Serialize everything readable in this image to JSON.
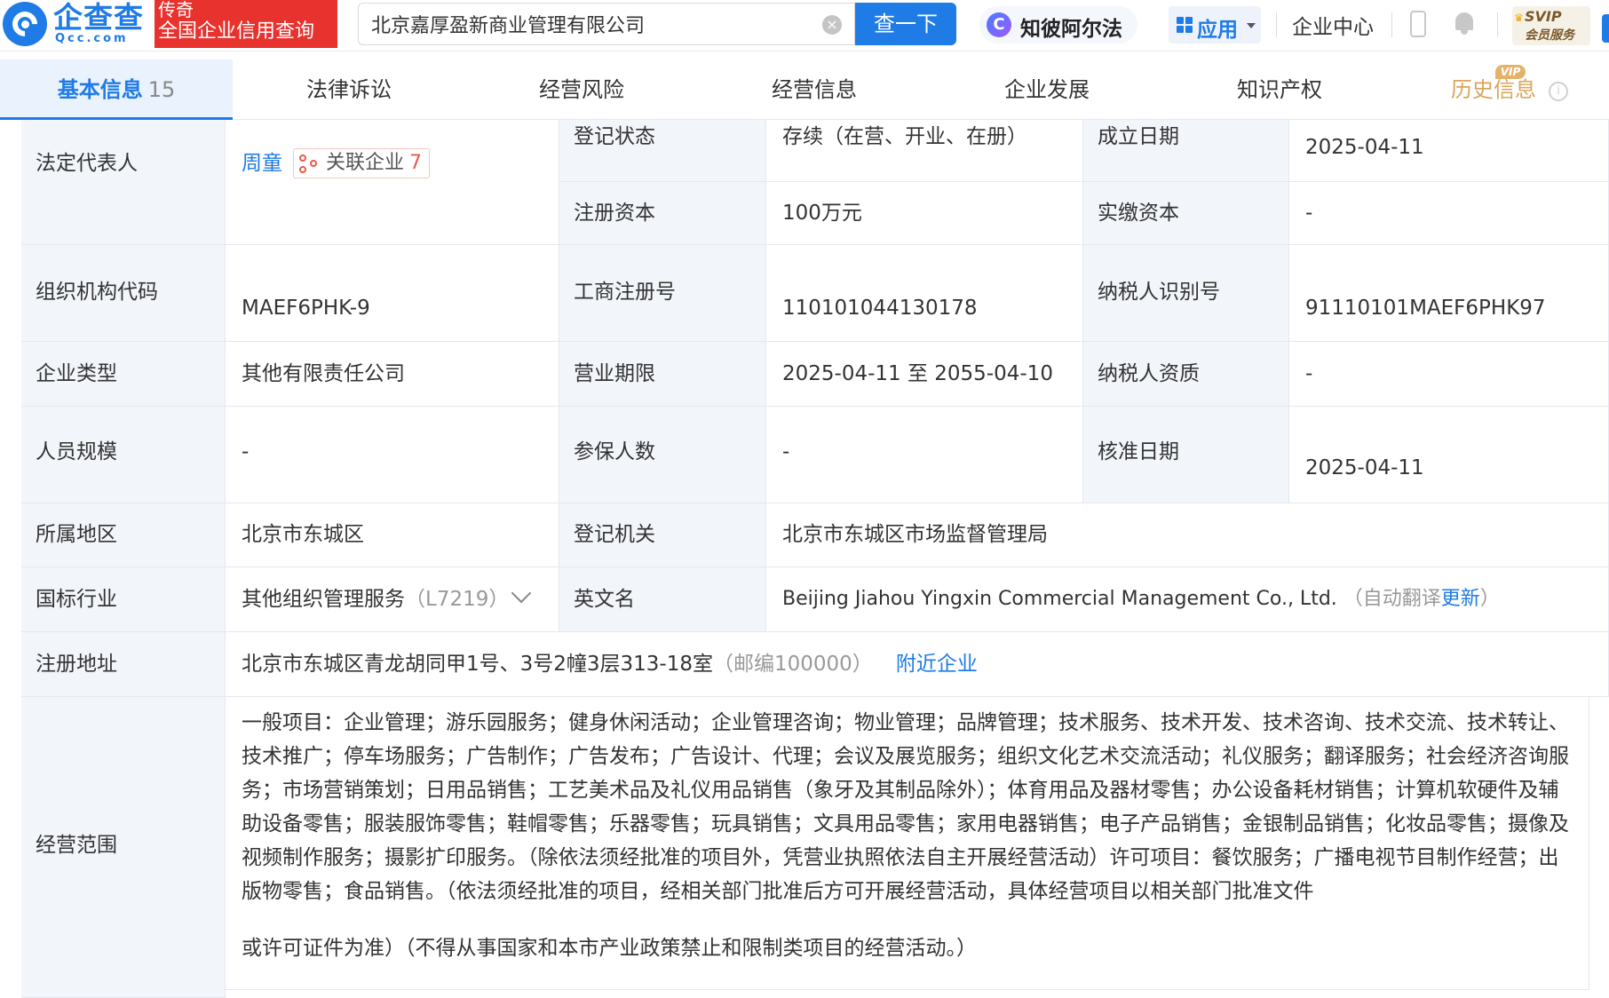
{
  "header": {
    "logo_text": "企查查",
    "logo_sub": "Qcc.com",
    "badge_line1": "传奇",
    "badge_line2": "全国企业信用查询",
    "search_value": "北京嘉厚盈新商业管理有限公司",
    "search_button": "查一下",
    "zhibi_label": "知彼阿尔法",
    "zhibi_icon": "C",
    "apps_label": "应用",
    "enterprise_center": "企业中心",
    "svip_line1": "SVIP",
    "svip_line2": "会员服务",
    "clear_glyph": "×"
  },
  "tabs": [
    {
      "label": "基本信息",
      "count": "15"
    },
    {
      "label": "法律诉讼"
    },
    {
      "label": "经营风险"
    },
    {
      "label": "经营信息"
    },
    {
      "label": "企业发展"
    },
    {
      "label": "知识产权"
    },
    {
      "label": "历史信息",
      "badge": "VIP"
    }
  ],
  "info_glyph": "i",
  "company": {
    "legal_rep_label": "法定代表人",
    "legal_rep_name": "周童",
    "related_label": "关联企业",
    "related_count": "7",
    "reg_status_label": "登记状态",
    "reg_status_value": "存续（在营、开业、在册）",
    "founded_label": "成立日期",
    "founded_value": "2025-04-11",
    "reg_capital_label": "注册资本",
    "reg_capital_value": "100万元",
    "paid_capital_label": "实缴资本",
    "paid_capital_value": "-",
    "org_code_label": "组织机构代码",
    "org_code_value": "MAEF6PHK-9",
    "biz_reg_no_label": "工商注册号",
    "biz_reg_no_value": "110101044130178",
    "taxpayer_id_label": "纳税人识别号",
    "taxpayer_id_value": "91110101MAEF6PHK97",
    "type_label": "企业类型",
    "type_value": "其他有限责任公司",
    "term_label": "营业期限",
    "term_value": "2025-04-11 至 2055-04-10",
    "taxpayer_qual_label": "纳税人资质",
    "taxpayer_qual_value": "-",
    "staff_label": "人员规模",
    "staff_value": "-",
    "insured_label": "参保人数",
    "insured_value": "-",
    "approved_label": "核准日期",
    "approved_value": "2025-04-11",
    "region_label": "所属地区",
    "region_value": "北京市东城区",
    "authority_label": "登记机关",
    "authority_value": "北京市东城区市场监督管理局",
    "industry_label": "国标行业",
    "industry_value": "其他组织管理服务",
    "industry_code": "（L7219）",
    "english_label": "英文名",
    "english_value": "Beijing Jiahou Yingxin Commercial Management Co., Ltd.",
    "auto_translate_prefix": "（自动翻译",
    "auto_translate_link": "更新",
    "auto_translate_suffix": "）",
    "address_label": "注册地址",
    "address_value": "北京市东城区青龙胡同甲1号、3号2幢3层313-18室",
    "postcode": "（邮编100000）",
    "nearby_link": "附近企业",
    "scope_label": "经营范围",
    "scope_main": "一般项目：企业管理；游乐园服务；健身休闲活动；企业管理咨询；物业管理；品牌管理；技术服务、技术开发、技术咨询、技术交流、技术转让、技术推广；停车场服务；广告制作；广告发布；广告设计、代理；会议及展览服务；组织文化艺术交流活动；礼仪服务；翻译服务；社会经济咨询服务；市场营销策划；日用品销售；工艺美术品及礼仪用品销售（象牙及其制品除外）；体育用品及器材零售；办公设备耗材销售；计算机软硬件及辅助设备零售；服装服饰零售；鞋帽零售；乐器零售；玩具销售；文具用品零售；家用电器销售；电子产品销售；金银制品销售；化妆品零售；摄像及视频制作服务；摄影扩印服务。（除依法须经批准的项目外，凭营业执照依法自主开展经营活动）许可项目：餐饮服务；广播电视节目制作经营；出版物零售；食品销售。（依法须经批准的项目，经相关部门批准后方可开展经营活动，具体经营项目以相关部门批准文件",
    "scope_tail": "或许可证件为准）（不得从事国家和本市产业政策禁止和限制类项目的经营活动。）"
  }
}
